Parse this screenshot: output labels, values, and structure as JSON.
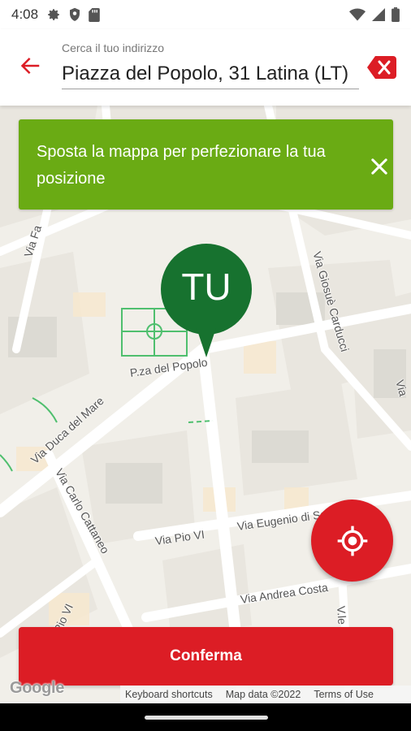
{
  "status_bar": {
    "time": "4:08",
    "left_icons": [
      "gear-icon",
      "shield-icon",
      "sd-card-icon"
    ],
    "right_icons": [
      "wifi-icon",
      "signal-icon",
      "battery-icon"
    ]
  },
  "search": {
    "label": "Cerca il tuo indirizzo",
    "value": "Piazza del Popolo, 31 Latina (LT)"
  },
  "banner": {
    "message": "Sposta la mappa per perfezionare la tua posizione",
    "color": "#6aab14"
  },
  "map": {
    "pin_label": "TU",
    "pin_color": "#17722f",
    "street_labels": [
      "Via Fa",
      "P.za del Popolo",
      "Via Giosuè Carducci",
      "Via Duca del Mare",
      "Via Carlo Cattaneo",
      "Via Pio VI",
      "Via Eugenio di Savoia",
      "Via Andrea Costa",
      "Pio VI",
      "V.le P",
      "Via"
    ],
    "google_logo": "Google",
    "attribution": {
      "shortcuts": "Keyboard shortcuts",
      "map_data": "Map data ©2022",
      "terms": "Terms of Use"
    }
  },
  "confirm_button": {
    "label": "Conferma"
  },
  "colors": {
    "accent": "#dc1d25",
    "banner": "#6aab14",
    "pin": "#17722f"
  }
}
